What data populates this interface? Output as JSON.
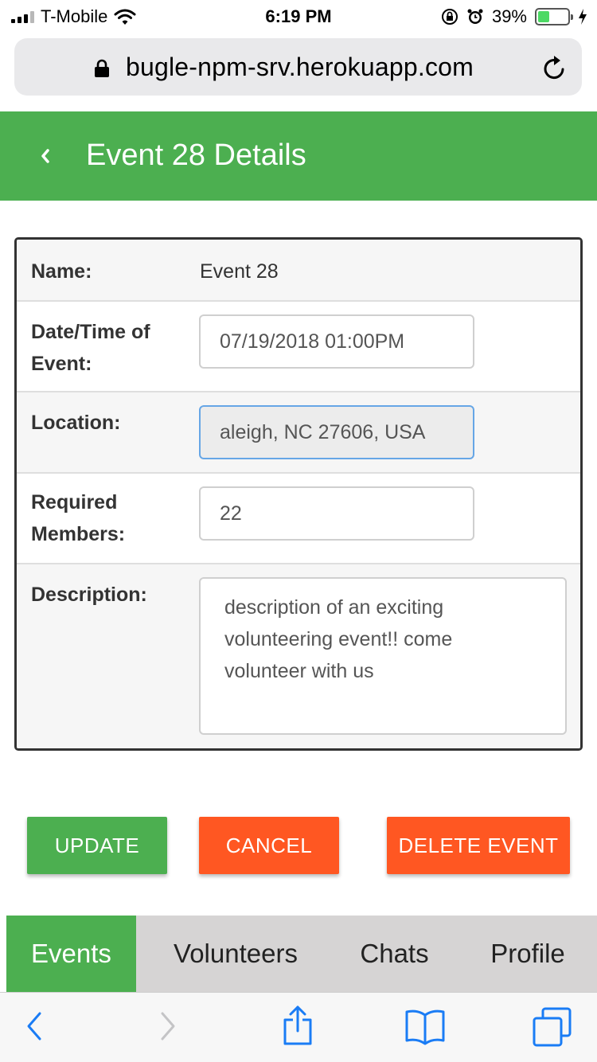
{
  "status_bar": {
    "carrier": "T-Mobile",
    "time": "6:19 PM",
    "battery_percent": "39%",
    "battery_level": 0.39,
    "icons": [
      "signal-icon",
      "wifi-icon",
      "orientation-lock-icon",
      "alarm-icon",
      "battery-icon",
      "charging-icon"
    ]
  },
  "browser": {
    "url": "bugle-npm-srv.herokuapp.com",
    "icons": [
      "lock-icon",
      "reload-icon"
    ]
  },
  "header": {
    "title": "Event 28 Details",
    "background_color": "#4caf50",
    "icon": "back-chevron-icon"
  },
  "details": {
    "name": {
      "label": "Name:",
      "value": "Event 28"
    },
    "datetime": {
      "label_line1": "Date/Time of",
      "label_line2": "Event:",
      "value": "07/19/2018 01:00PM"
    },
    "location": {
      "label": "Location:",
      "value": "aleigh, NC 27606, USA"
    },
    "required_members": {
      "label_line1": "Required",
      "label_line2": "Members:",
      "value": "22"
    },
    "description": {
      "label": "Description:",
      "value_line1": "description of an exciting",
      "value_line2": "volunteering event!! come",
      "value_line3": "volunteer with us"
    }
  },
  "actions": {
    "update_label": "UPDATE",
    "cancel_label": "CANCEL",
    "delete_label": "DELETE EVENT",
    "primary_color": "#4caf50",
    "danger_color": "#ff5722"
  },
  "tabs": [
    {
      "label": "Events",
      "active": true
    },
    {
      "label": "Volunteers",
      "active": false
    },
    {
      "label": "Chats",
      "active": false
    },
    {
      "label": "Profile",
      "active": false
    }
  ],
  "safari_toolbar": {
    "icons": [
      "back-arrow-icon",
      "forward-arrow-icon",
      "share-icon",
      "bookmarks-icon",
      "tabs-icon"
    ]
  }
}
